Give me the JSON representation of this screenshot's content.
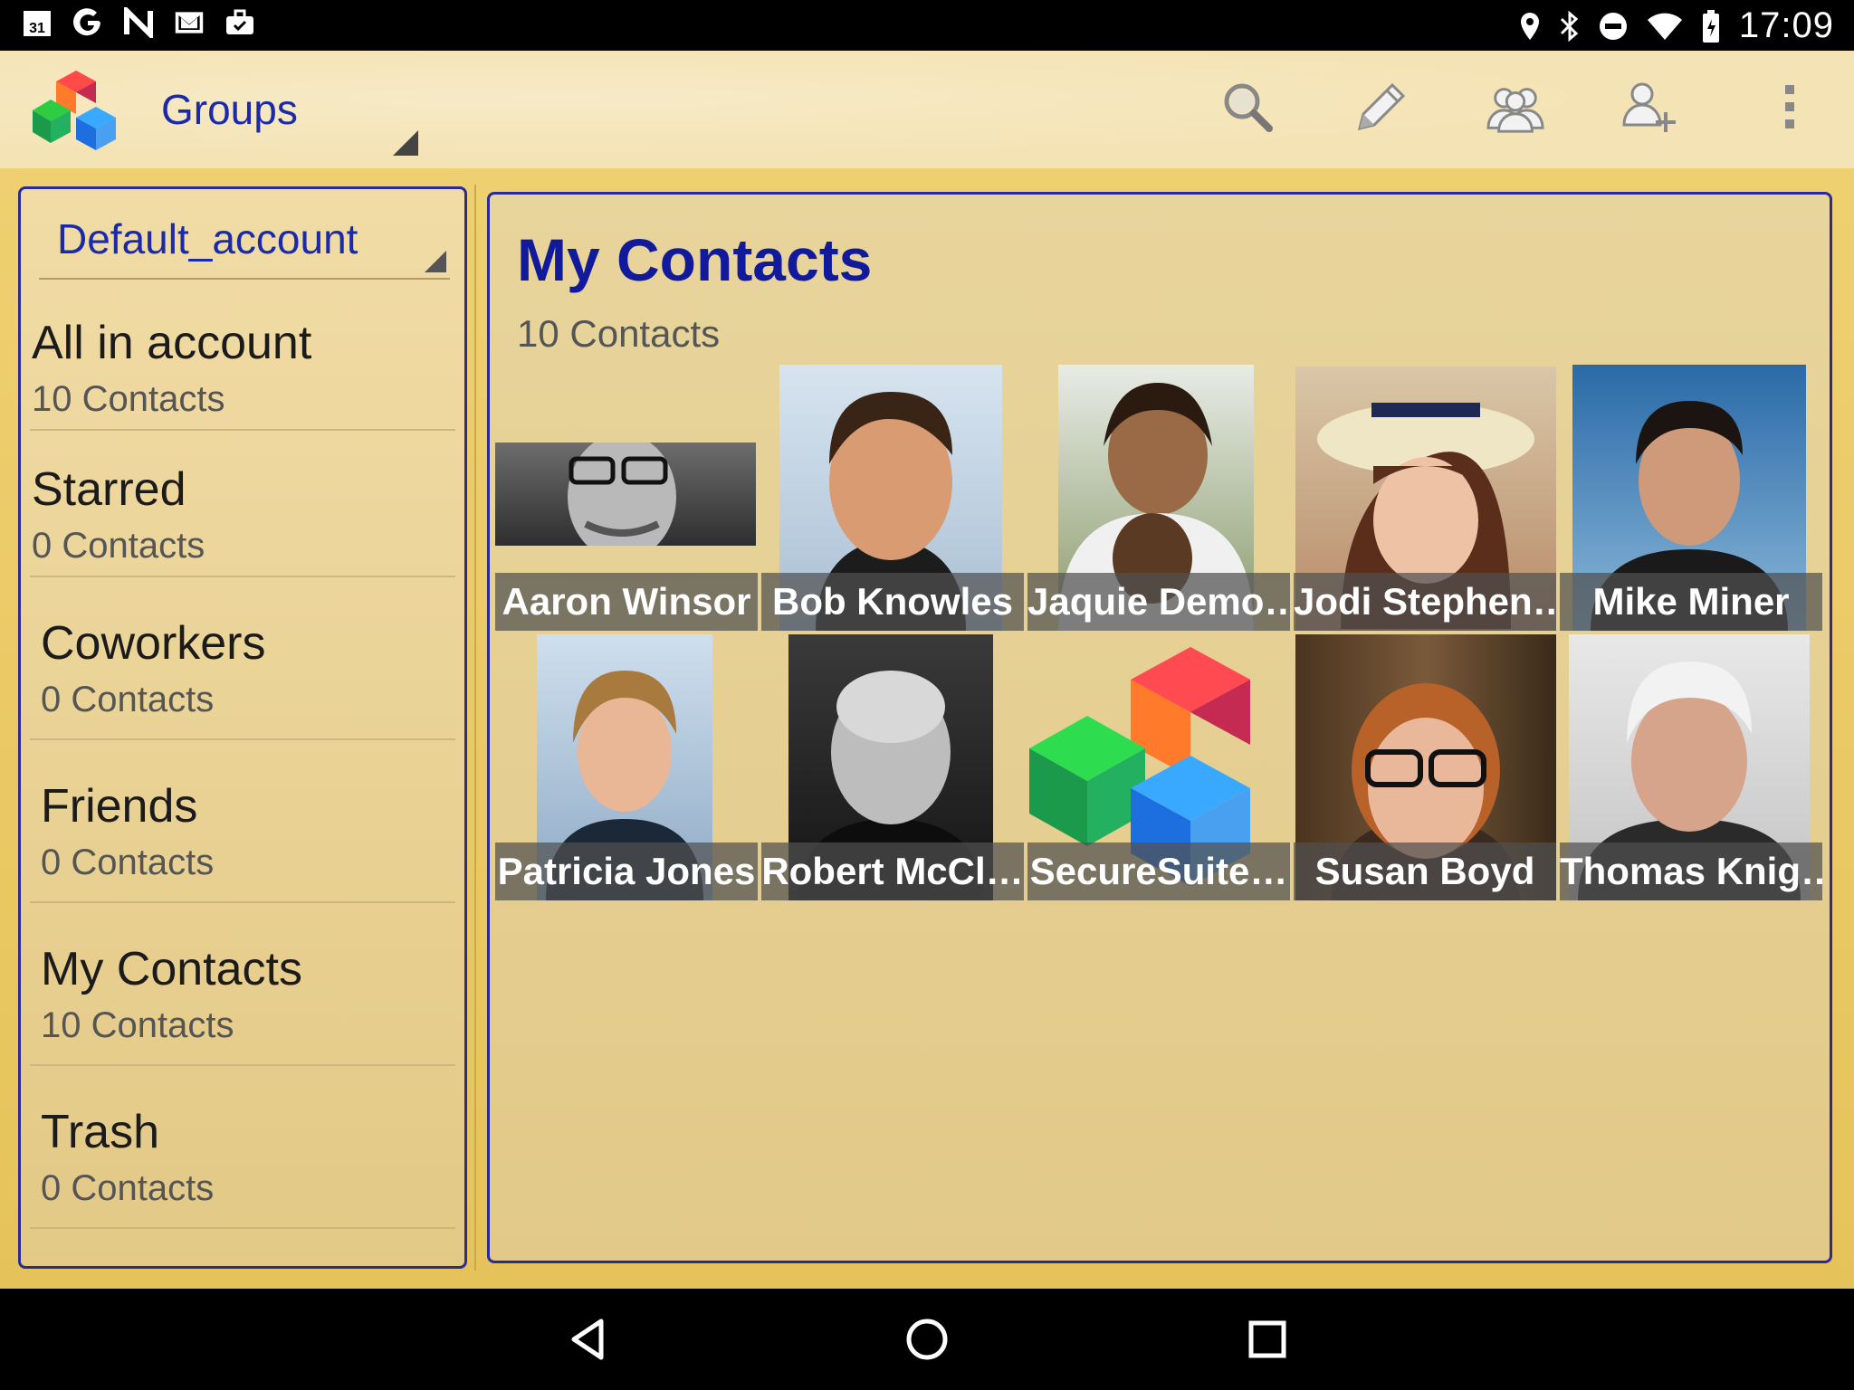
{
  "status_bar": {
    "time": "17:09",
    "left_icons": [
      "calendar-icon",
      "google-icon",
      "nfc-icon",
      "gmail-icon",
      "briefcase-icon"
    ],
    "right_icons": [
      "location-icon",
      "bluetooth-icon",
      "dnd-icon",
      "wifi-icon",
      "battery-icon"
    ],
    "calendar_day": "31"
  },
  "action_bar": {
    "selector_label": "Groups",
    "actions": [
      "search-icon",
      "edit-icon",
      "groups-icon",
      "add-contact-icon",
      "overflow-icon"
    ]
  },
  "sidebar": {
    "account": "Default_account",
    "groups": [
      {
        "name": "All in account",
        "count": "10 Contacts"
      },
      {
        "name": "Starred",
        "count": "0 Contacts"
      },
      {
        "name": "Coworkers",
        "count": "0 Contacts"
      },
      {
        "name": "Friends",
        "count": "0 Contacts"
      },
      {
        "name": "My Contacts",
        "count": "10 Contacts"
      },
      {
        "name": "Trash",
        "count": "0 Contacts"
      }
    ]
  },
  "main": {
    "title": "My Contacts",
    "count": "10 Contacts",
    "contacts": [
      {
        "name": "Aaron Winsor"
      },
      {
        "name": "Bob Knowles"
      },
      {
        "name": "Jaquie Demo…"
      },
      {
        "name": "Jodi Stephen…"
      },
      {
        "name": "Mike Miner"
      },
      {
        "name": "Patricia Jones"
      },
      {
        "name": "Robert McCl…"
      },
      {
        "name": "SecureSuite…"
      },
      {
        "name": "Susan Boyd"
      },
      {
        "name": "Thomas Knig…"
      }
    ]
  },
  "nav_bar": {
    "buttons": [
      "back-icon",
      "home-icon",
      "recents-icon"
    ]
  }
}
